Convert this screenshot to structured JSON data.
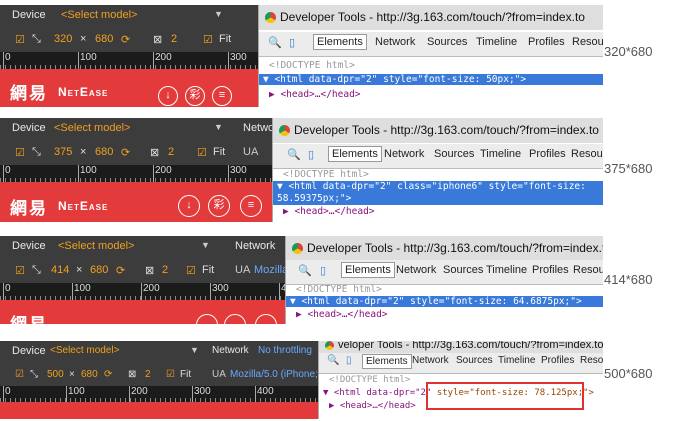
{
  "common": {
    "device_label": "Device",
    "select_model": "<Select model>",
    "network_label": "Network",
    "no_throttling": "No throttling",
    "ua_label": "UA",
    "ua_value_partial": "Mozilla",
    "ua_value_full": "Mozilla/5.0 (iPhone;",
    "times": "×",
    "scale": "2",
    "fit": "Fit",
    "logo_cn": "網易",
    "logo_en": "NetEase",
    "devtools_title": "Developer Tools - http://3g.163.com/touch/?from=index.to",
    "doctype": "<!DOCTYPE html>",
    "head": "<head>…</head>",
    "tabs": [
      "Elements",
      "Network",
      "Sources",
      "Timeline",
      "Profiles",
      "Resour"
    ]
  },
  "panels": [
    {
      "width": "320",
      "height": "680",
      "size_label": "320*680",
      "ruler": [
        "0",
        "100",
        "200",
        "300"
      ],
      "html_line": "<html data-dpr=\"2\" style=\"font-size: 50px;\">",
      "html_line2": ""
    },
    {
      "width": "375",
      "height": "680",
      "size_label": "375*680",
      "ruler": [
        "0",
        "100",
        "200",
        "300"
      ],
      "html_line": "<html data-dpr=\"2\" class=\"iphone6\" style=\"font-size:",
      "html_line2": "58.59375px;\">"
    },
    {
      "width": "414",
      "height": "680",
      "size_label": "414*680",
      "ruler": [
        "0",
        "100",
        "200",
        "300",
        "400"
      ],
      "html_line": "<html data-dpr=\"2\" style=\"font-size: 64.6875px;\">",
      "html_line2": ""
    },
    {
      "width": "500",
      "height": "680",
      "size_label": "500*680",
      "ruler": [
        "0",
        "100",
        "200",
        "300",
        "400"
      ],
      "html_line_a": "<html data-dpr=\"2\"",
      "html_line_b": "style=\"font-size: 78.125px;\">",
      "devtools_title_partial": "veloper Tools - http://3g.163.com/touch/?from=index.to"
    }
  ]
}
